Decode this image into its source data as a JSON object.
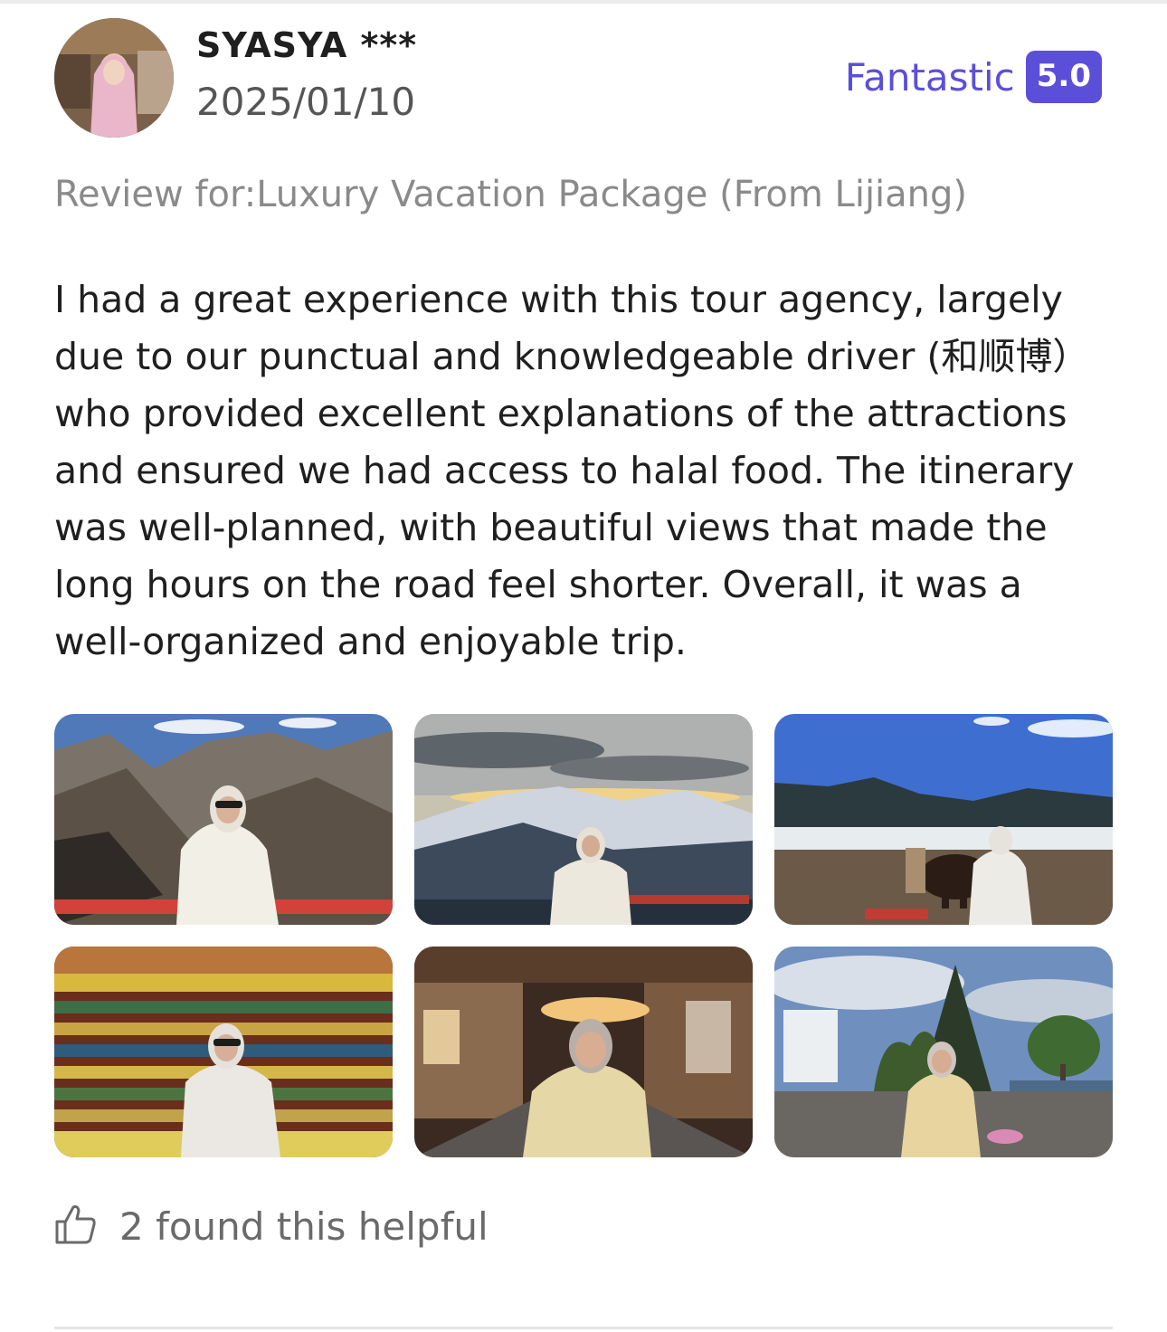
{
  "review": {
    "user_name": "SYASYA ***",
    "date": "2025/01/10",
    "rating_label": "Fantastic",
    "rating_score": "5.0",
    "review_for": "Review for:Luxury Vacation Package (From Lijiang)",
    "text": "I had a great experience with this tour agency, largely due to our punctual and knowledgeable driver (和顺博） who provided excellent explanations of the attractions and ensured we had access to halal food. The itinerary was well-planned, with beautiful views that made the long hours on the road feel shorter. Overall, it was a well-organized and enjoyable trip.",
    "photos": [
      {
        "scene": "mountain-canyon-viewpoint"
      },
      {
        "scene": "snow-mountain-sunset"
      },
      {
        "scene": "lake-shore-with-horse"
      },
      {
        "scene": "prayer-flags-wall"
      },
      {
        "scene": "old-town-street-night"
      },
      {
        "scene": "lakeside-promenade"
      }
    ],
    "helpful_text": "2 found this helpful",
    "helpful_icon": "thumbs-up-icon"
  },
  "colors": {
    "accent": "#5b4fd9",
    "muted_text": "#8a8a8a",
    "body_text": "#1f1f1f"
  }
}
